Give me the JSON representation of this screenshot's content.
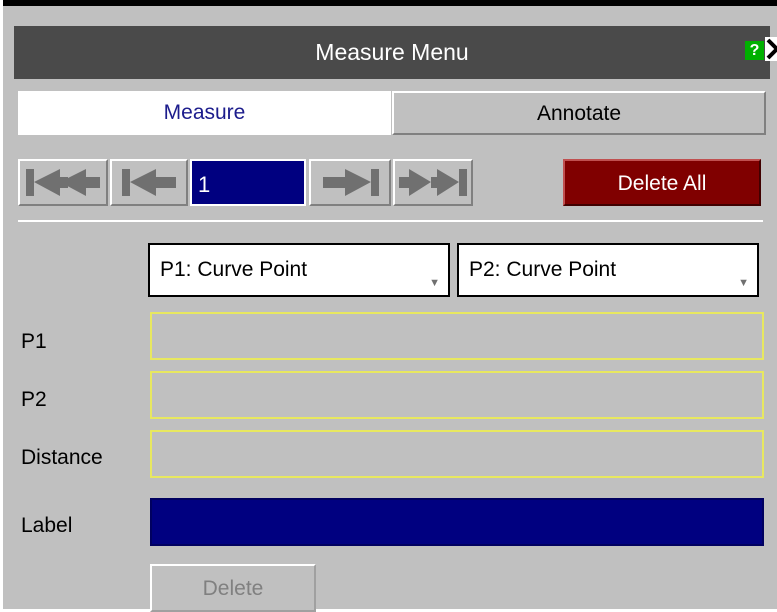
{
  "window": {
    "title": "Measure Menu",
    "help_label": "?",
    "close_icon": "close-icon"
  },
  "tabs": [
    {
      "label": "Measure",
      "active": true
    },
    {
      "label": "Annotate",
      "active": false
    }
  ],
  "navigation": {
    "current_page": "1",
    "buttons": [
      "first-page-icon",
      "previous-page-icon",
      "next-page-icon",
      "last-page-icon"
    ]
  },
  "actions": {
    "delete_all_label": "Delete All",
    "delete_label": "Delete"
  },
  "point_types": {
    "p1": "P1: Curve Point",
    "p2": "P2: Curve Point"
  },
  "rows": {
    "p1_label": "P1",
    "p2_label": "P2",
    "distance_label": "Distance",
    "label_label": "Label"
  },
  "colors": {
    "title_bar": "#4a4a4a",
    "panel": "#c0c0c0",
    "active_tab_text": "#1c1c8c",
    "selected_field": "#000080",
    "delete_all": "#800000",
    "field_outline": "#e8e860",
    "help": "#00b000"
  }
}
